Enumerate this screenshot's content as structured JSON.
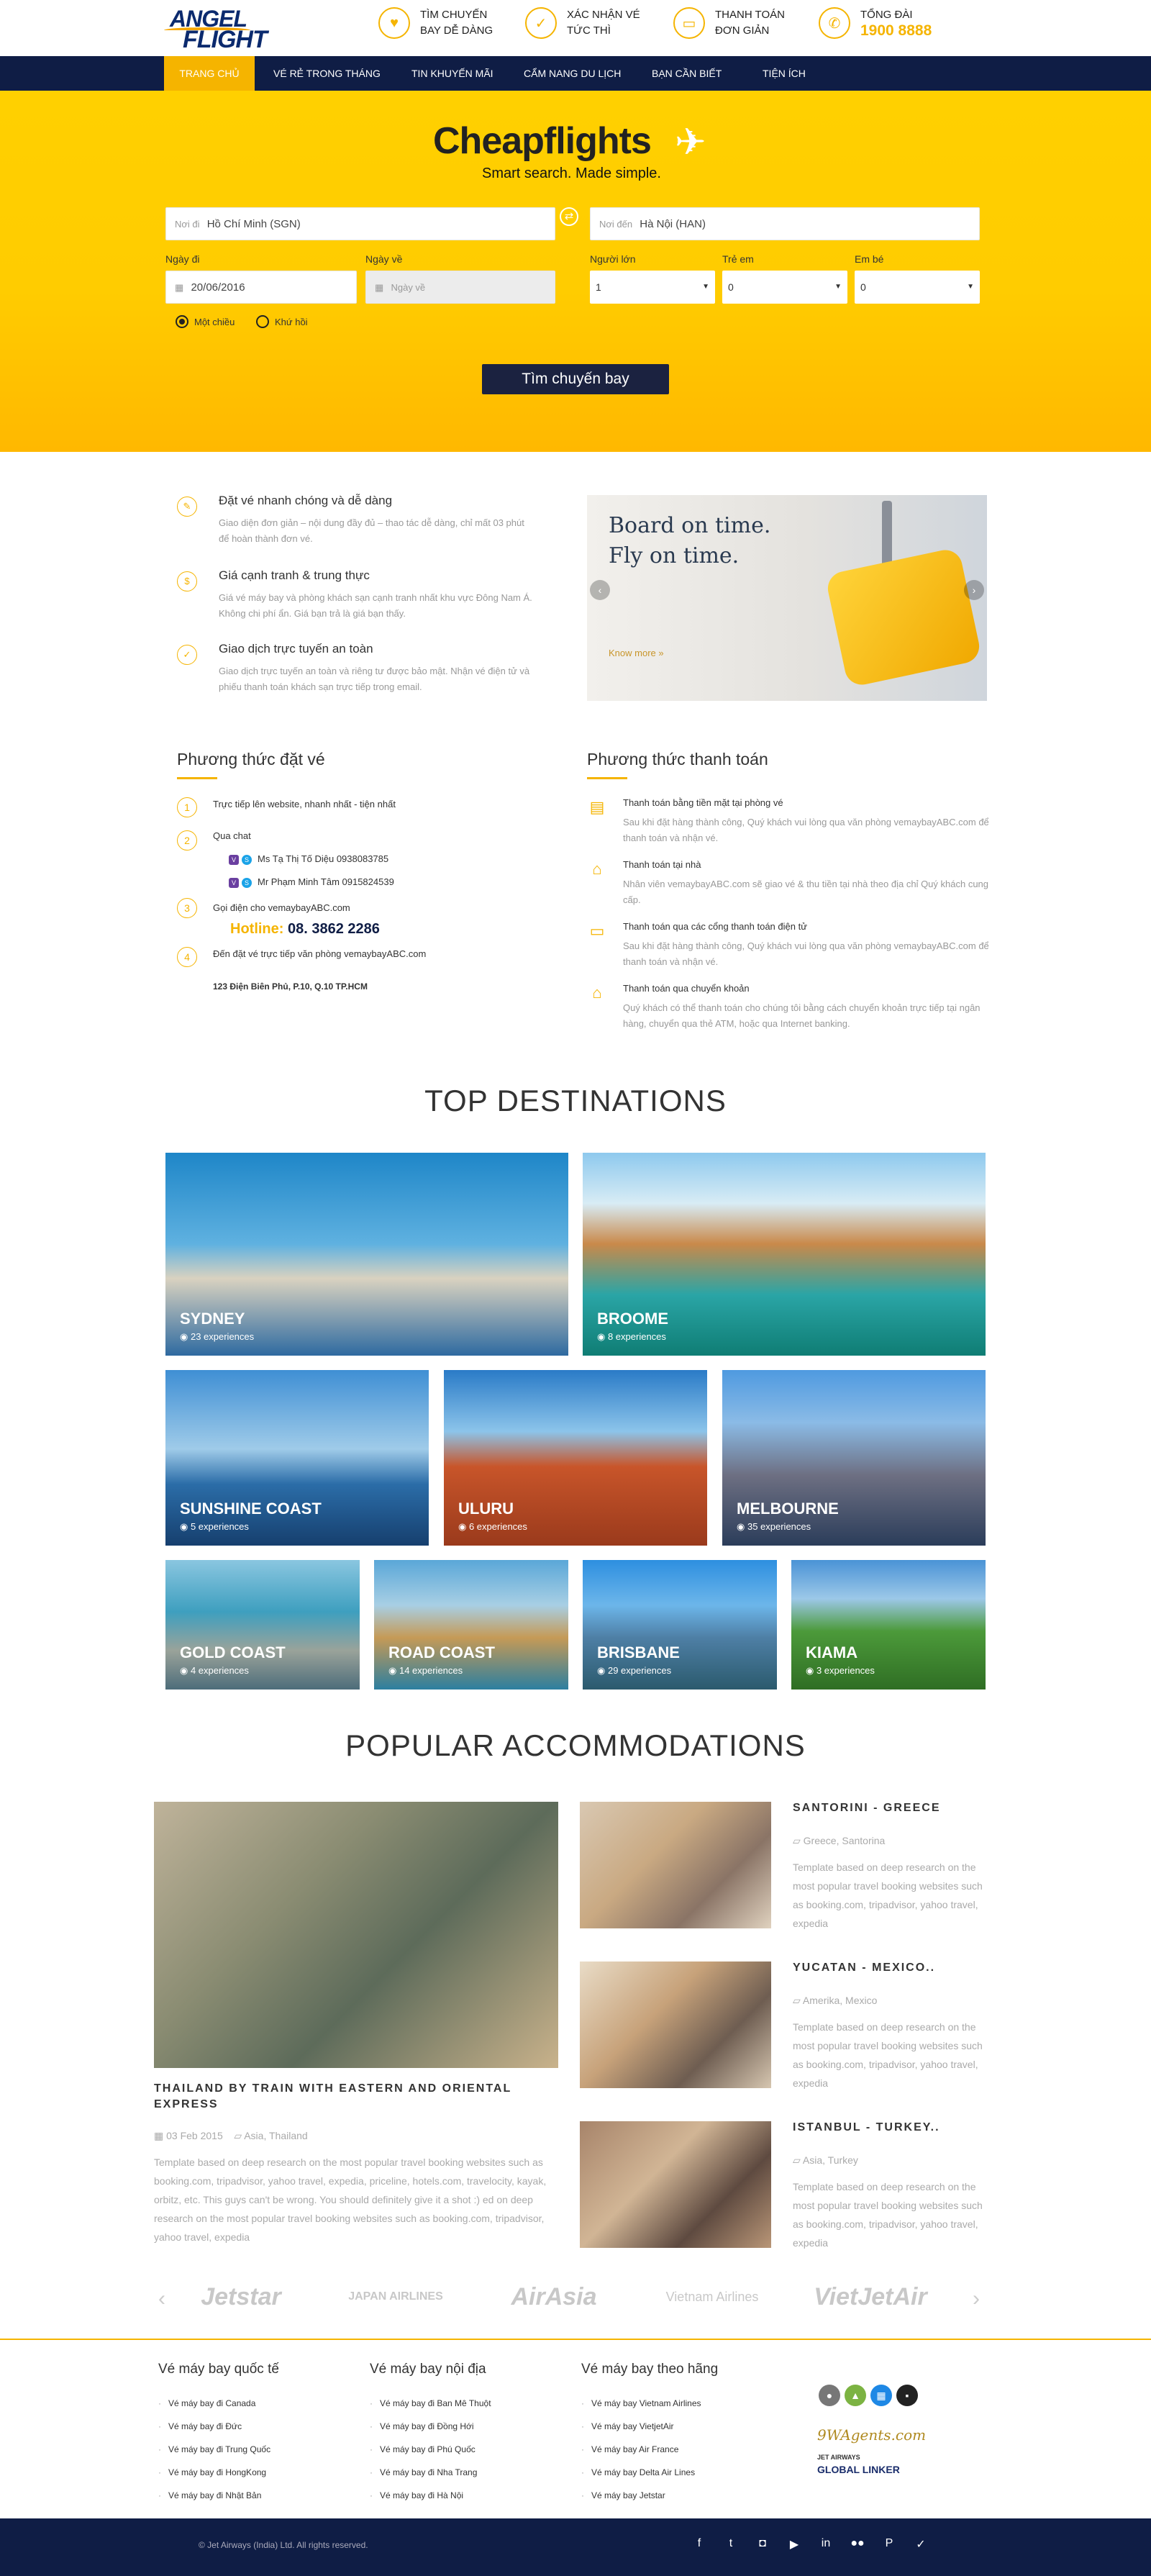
{
  "header": {
    "logo_line1": "ANGEL",
    "logo_line2": "FLIGHT",
    "features": [
      {
        "icon": "heart-icon",
        "line1": "TÌM CHUYẾN",
        "line2": "BAY DỄ DÀNG"
      },
      {
        "icon": "check-icon",
        "line1": "XÁC NHẬN VÉ",
        "line2": "TỨC THÌ"
      },
      {
        "icon": "card-icon",
        "line1": "THANH TOÁN",
        "line2": "ĐƠN GIẢN"
      },
      {
        "icon": "phone-icon",
        "line1": "TỔNG ĐÀI",
        "line2": "1900 8888"
      }
    ]
  },
  "nav": [
    "TRANG CHỦ",
    "VÉ RẺ TRONG THÁNG",
    "TIN KHUYẾN MÃI",
    "CẨM NANG DU LỊCH",
    "BẠN CẦN BIẾT",
    "TIỆN ÍCH"
  ],
  "hero": {
    "title": "Cheapflights",
    "subtitle": "Smart search. Made simple.",
    "from_prefix": "Nơi đi",
    "from_value": "Hồ Chí Minh (SGN)",
    "to_prefix": "Nơi đến",
    "to_value": "Hà Nội (HAN)",
    "depart_label": "Ngày đi",
    "depart_value": "20/06/2016",
    "return_label": "Ngày về",
    "return_placeholder": "Ngày về",
    "adult_label": "Người lớn",
    "adult_value": "1",
    "child_label": "Trẻ em",
    "child_value": "0",
    "infant_label": "Em bé",
    "infant_value": "0",
    "oneway": "Một chiều",
    "roundtrip": "Khứ hồi",
    "search_button": "Tìm chuyến bay"
  },
  "benefits": [
    {
      "icon": "ticket-icon",
      "title": "Đặt vé nhanh chóng và dễ dàng",
      "desc": "Giao diện đơn giản – nội dung đầy đủ – thao tác dễ dàng, chỉ mất 03 phút để hoàn thành đơn vé."
    },
    {
      "icon": "dollar-icon",
      "title": "Giá cạnh tranh & trung thực",
      "desc": "Giá vé máy bay và phòng khách sạn cạnh tranh nhất khu vực Đông Nam Á. Không chi phí ẩn. Giá bạn trả là giá bạn thấy."
    },
    {
      "icon": "lock-icon",
      "title": "Giao dịch trực tuyến an toàn",
      "desc": "Giao dịch trực tuyến an toàn và riêng tư được bảo mật. Nhận vé điện tử và phiếu thanh toán khách sạn trực tiếp trong email."
    }
  ],
  "banner": {
    "line1": "Board on time.",
    "line2": "Fly on time.",
    "more": "Know more »"
  },
  "booking": {
    "title": "Phương thức đặt vé",
    "step1": "Trực tiếp lên website, nhanh nhất - tiện nhất",
    "step2": "Qua chat",
    "agent1": "Ms Tạ Thị Tố Diệu  0938083785",
    "agent2": "Mr Phạm Minh Tâm  0915824539",
    "step3": "Gọi điện cho vemaybayABC.com",
    "hotline_label": "Hotline:",
    "hotline_value": "08. 3862 2286",
    "step4": "Đến đặt vé trực tiếp văn phòng vemaybayABC.com",
    "address": "123 Điện Biên Phủ, P.10, Q.10 TP.HCM"
  },
  "payment": {
    "title": "Phương thức thanh toán",
    "items": [
      {
        "icon": "bank-card-icon",
        "title": "Thanh toán bằng tiền mặt tại phòng vé",
        "desc": "Sau khi đặt hàng thành công, Quý khách vui lòng qua văn phòng vemaybayABC.com để thanh toán và nhận vé."
      },
      {
        "icon": "home-icon",
        "title": "Thanh toán tại nhà",
        "desc": "Nhân viên vemaybayABC.com sẽ giao vé & thu tiền tại nhà theo địa chỉ Quý khách cung cấp."
      },
      {
        "icon": "folder-icon",
        "title": "Thanh toán qua các cổng thanh toán điện tử",
        "desc": "Sau khi đặt hàng thành công, Quý khách vui lòng qua văn phòng vemaybayABC.com để thanh toán và nhận vé."
      },
      {
        "icon": "bank-icon",
        "title": "Thanh toán qua chuyển khoản",
        "desc": "Quý khách có thể thanh toán cho chúng tôi bằng cách chuyển khoản trực tiếp tại ngân hàng, chuyển qua thẻ ATM, hoặc qua Internet banking."
      }
    ]
  },
  "destinations_title": "TOP DESTINATIONS",
  "destinations": [
    {
      "name": "SYDNEY",
      "exp": "23 experiences"
    },
    {
      "name": "BROOME",
      "exp": "8 experiences"
    },
    {
      "name": "SUNSHINE COAST",
      "exp": "5 experiences"
    },
    {
      "name": "ULURU",
      "exp": "6 experiences"
    },
    {
      "name": "MELBOURNE",
      "exp": "35 experiences"
    },
    {
      "name": "GOLD COAST",
      "exp": "4 experiences"
    },
    {
      "name": "ROAD COAST",
      "exp": "14 experiences"
    },
    {
      "name": "BRISBANE",
      "exp": "29 experiences"
    },
    {
      "name": "KIAMA",
      "exp": "3 experiences"
    }
  ],
  "accommodations_title": "POPULAR ACCOMMODATIONS",
  "feature_post": {
    "title": "THAILAND BY TRAIN WITH EASTERN AND ORIENTAL EXPRESS",
    "date": "03 Feb 2015",
    "location": "Asia, Thailand",
    "desc": "Template based on deep research on the most popular travel booking websites such as booking.com, tripadvisor, yahoo travel, expedia, priceline, hotels.com, travelocity, kayak, orbitz, etc. This guys can't be wrong. You should definitely give it a shot :) ed on deep research on the most popular travel booking websites such as booking.com, tripadvisor, yahoo travel, expedia"
  },
  "side_posts": [
    {
      "title": "SANTORINI - GREECE",
      "loc": "Greece, Santorina",
      "desc": "Template based on deep research on the most popular travel booking websites such as booking.com, tripadvisor, yahoo travel, expedia"
    },
    {
      "title": "YUCATAN - MEXICO..",
      "loc": "Amerika, Mexico",
      "desc": "Template based on deep research on the most popular travel booking websites such as booking.com, tripadvisor, yahoo travel, expedia"
    },
    {
      "title": "ISTANBUL - TURKEY..",
      "loc": "Asia, Turkey",
      "desc": "Template based on deep research on the most popular travel booking websites such as booking.com, tripadvisor, yahoo travel, expedia"
    }
  ],
  "partners": [
    "Jetstar",
    "JAPAN AIRLINES",
    "AirAsia",
    "Vietnam Airlines",
    "VietJetAir"
  ],
  "footer": {
    "col1_title": "Vé máy bay quốc tế",
    "col1": [
      "Vé máy bay đi Canada",
      "Vé máy bay đi Đức",
      "Vé máy bay đi Trung Quốc",
      "Vé máy bay đi HongKong",
      "Vé máy bay đi Nhật Bản"
    ],
    "col2_title": "Vé máy bay nội địa",
    "col2": [
      "Vé máy bay đi Ban Mê Thuột",
      "Vé máy bay đi Đồng Hới",
      "Vé máy bay đi Phú Quốc",
      "Vé máy bay đi Nha Trang",
      "Vé máy bay đi Hà Nội"
    ],
    "col3_title": "Vé máy bay theo hãng",
    "col3": [
      "Vé máy bay Vietnam Airlines",
      "Vé máy bay VietjetAir",
      "Vé máy bay Air France",
      "Vé máy bay Delta Air Lines",
      "Vé máy bay Jetstar"
    ],
    "agents_brand": "9WAgents.com",
    "jet_small": "JET AIRWAYS",
    "globalinker": "GLOBAL LINKER",
    "copyright": "© Jet Airways (India) Ltd. All rights reserved."
  },
  "colors": {
    "accent": "#f5b400",
    "navy": "#0f1d45",
    "hero": "#ffcc00"
  }
}
